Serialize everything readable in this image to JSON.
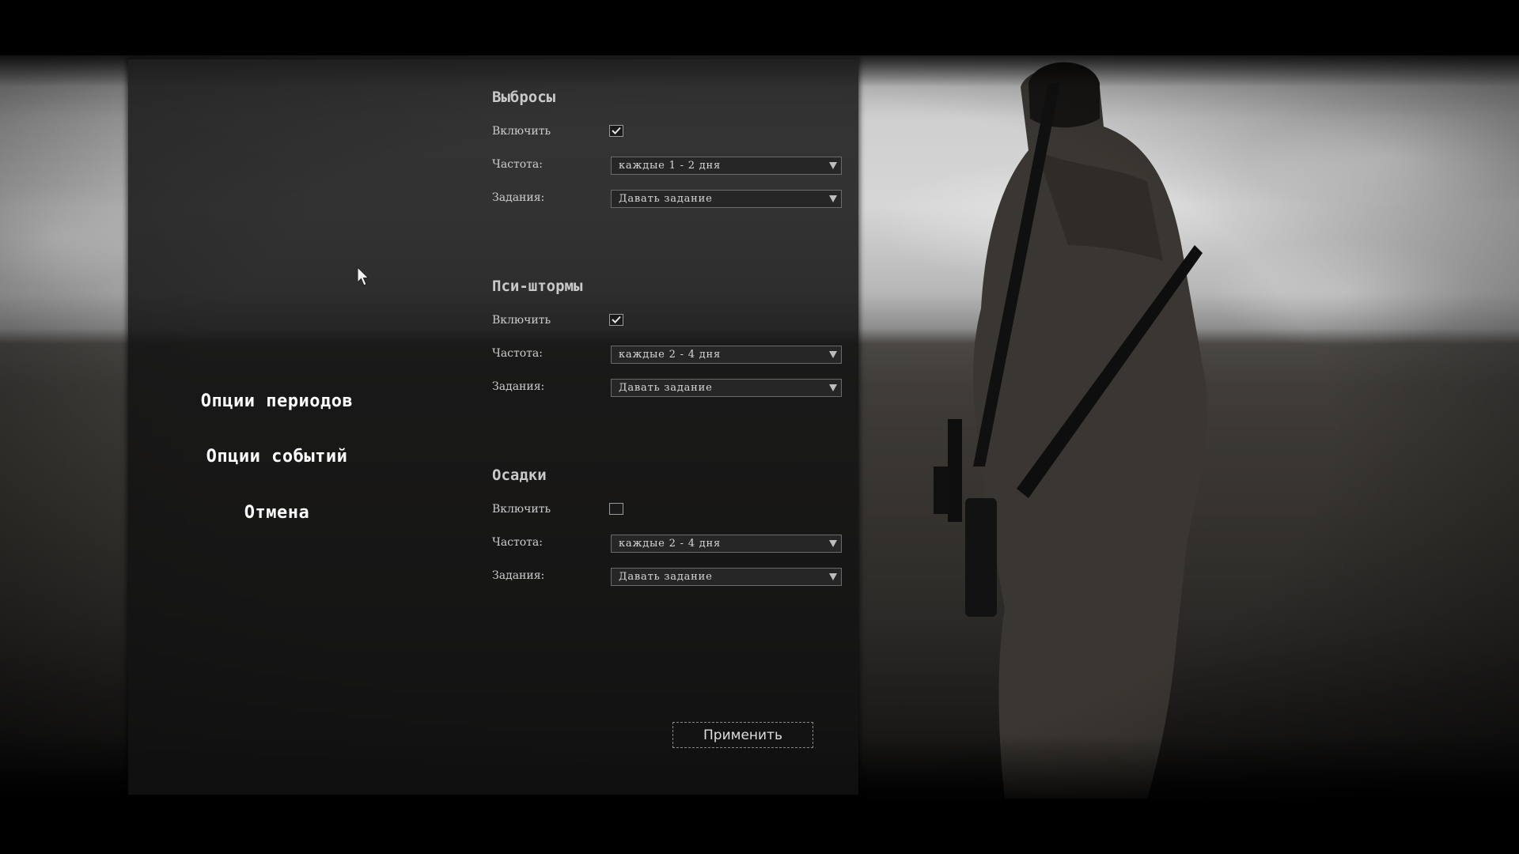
{
  "nav": {
    "items": [
      {
        "label": "Опции периодов"
      },
      {
        "label": "Опции событий"
      },
      {
        "label": "Отмена"
      }
    ]
  },
  "sections": [
    {
      "title": "Выбросы",
      "enable_label": "Включить",
      "enabled": true,
      "frequency_label": "Частота:",
      "frequency_value": "каждые 1 - 2 дня",
      "tasks_label": "Задания:",
      "tasks_value": "Давать задание"
    },
    {
      "title": "Пси-штормы",
      "enable_label": "Включить",
      "enabled": true,
      "frequency_label": "Частота:",
      "frequency_value": "каждые 2 - 4 дня",
      "tasks_label": "Задания:",
      "tasks_value": "Давать задание"
    },
    {
      "title": "Осадки",
      "enable_label": "Включить",
      "enabled": false,
      "frequency_label": "Частота:",
      "frequency_value": "каждые 2 - 4 дня",
      "tasks_label": "Задания:",
      "tasks_value": "Давать задание"
    }
  ],
  "apply": {
    "label": "Применить"
  },
  "icons": [
    "checkmark-icon",
    "chevron-down-icon",
    "mouse-cursor-icon"
  ]
}
